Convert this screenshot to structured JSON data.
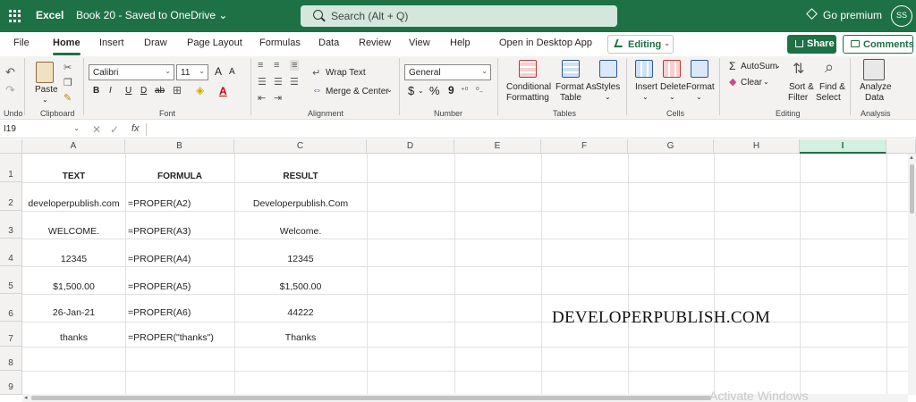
{
  "titlebar": {
    "app": "Excel",
    "document": "Book 20 - Saved to OneDrive ⌄",
    "search_placeholder": "Search (Alt + Q)",
    "premium": "Go premium",
    "avatar_initials": "SS"
  },
  "tabs": [
    "File",
    "Home",
    "Insert",
    "Draw",
    "Page Layout",
    "Formulas",
    "Data",
    "Review",
    "View",
    "Help",
    "Open in Desktop App"
  ],
  "active_tab": "Home",
  "actions": {
    "editing": "Editing",
    "share": "Share",
    "comments": "Comments"
  },
  "ribbon": {
    "undo_label": "Undo",
    "clipboard": {
      "paste": "Paste",
      "label": "Clipboard"
    },
    "font": {
      "name": "Calibri",
      "size": "11",
      "label": "Font",
      "bold": "B",
      "italic": "I",
      "underline": "U",
      "double_underline": "D",
      "strike": "ab",
      "grow": "A",
      "shrink": "A"
    },
    "alignment": {
      "wrap": "Wrap Text",
      "merge": "Merge & Center",
      "label": "Alignment"
    },
    "number": {
      "format": "General",
      "currency": "$",
      "percent": "%",
      "comma": "9",
      "label": "Number"
    },
    "tables": {
      "conditional": "Conditional",
      "conditional2": "Formatting",
      "format_as": "Format As",
      "format_as2": "Table",
      "styles": "Styles",
      "label": "Tables"
    },
    "cells": {
      "insert": "Insert",
      "delete": "Delete",
      "format": "Format",
      "label": "Cells"
    },
    "editing": {
      "autosum": "AutoSum",
      "clear": "Clear",
      "sort": "Sort &",
      "sort2": "Filter",
      "find": "Find &",
      "find2": "Select",
      "label": "Editing"
    },
    "analysis": {
      "analyze": "Analyze",
      "analyze2": "Data",
      "label": "Analysis"
    }
  },
  "formula_bar": {
    "name_box": "I19",
    "fx": "fx",
    "value": ""
  },
  "columns": [
    "A",
    "B",
    "C",
    "D",
    "E",
    "F",
    "G",
    "H",
    "I"
  ],
  "selected_column": "I",
  "rows": [
    "1",
    "2",
    "3",
    "4",
    "5",
    "6",
    "7",
    "8",
    "9"
  ],
  "sheet": {
    "headers": {
      "a": "TEXT",
      "b": "FORMULA",
      "c": "RESULT"
    },
    "data": [
      {
        "a": "developerpublish.com",
        "b": "=PROPER(A2)",
        "c": "Developerpublish.Com"
      },
      {
        "a": "WELCOME.",
        "b": "=PROPER(A3)",
        "c": "Welcome."
      },
      {
        "a": "12345",
        "b": "=PROPER(A4)",
        "c": "12345"
      },
      {
        "a": "$1,500.00",
        "b": "=PROPER(A5)",
        "c": "$1,500.00"
      },
      {
        "a": "26-Jan-21",
        "b": "=PROPER(A6)",
        "c": "44222"
      },
      {
        "a": "thanks",
        "b": "=PROPER(\"thanks\")",
        "c": "Thanks"
      }
    ]
  },
  "watermark": "DEVELOPERPUBLISH.COM",
  "activation_notice": "Activate Windows"
}
